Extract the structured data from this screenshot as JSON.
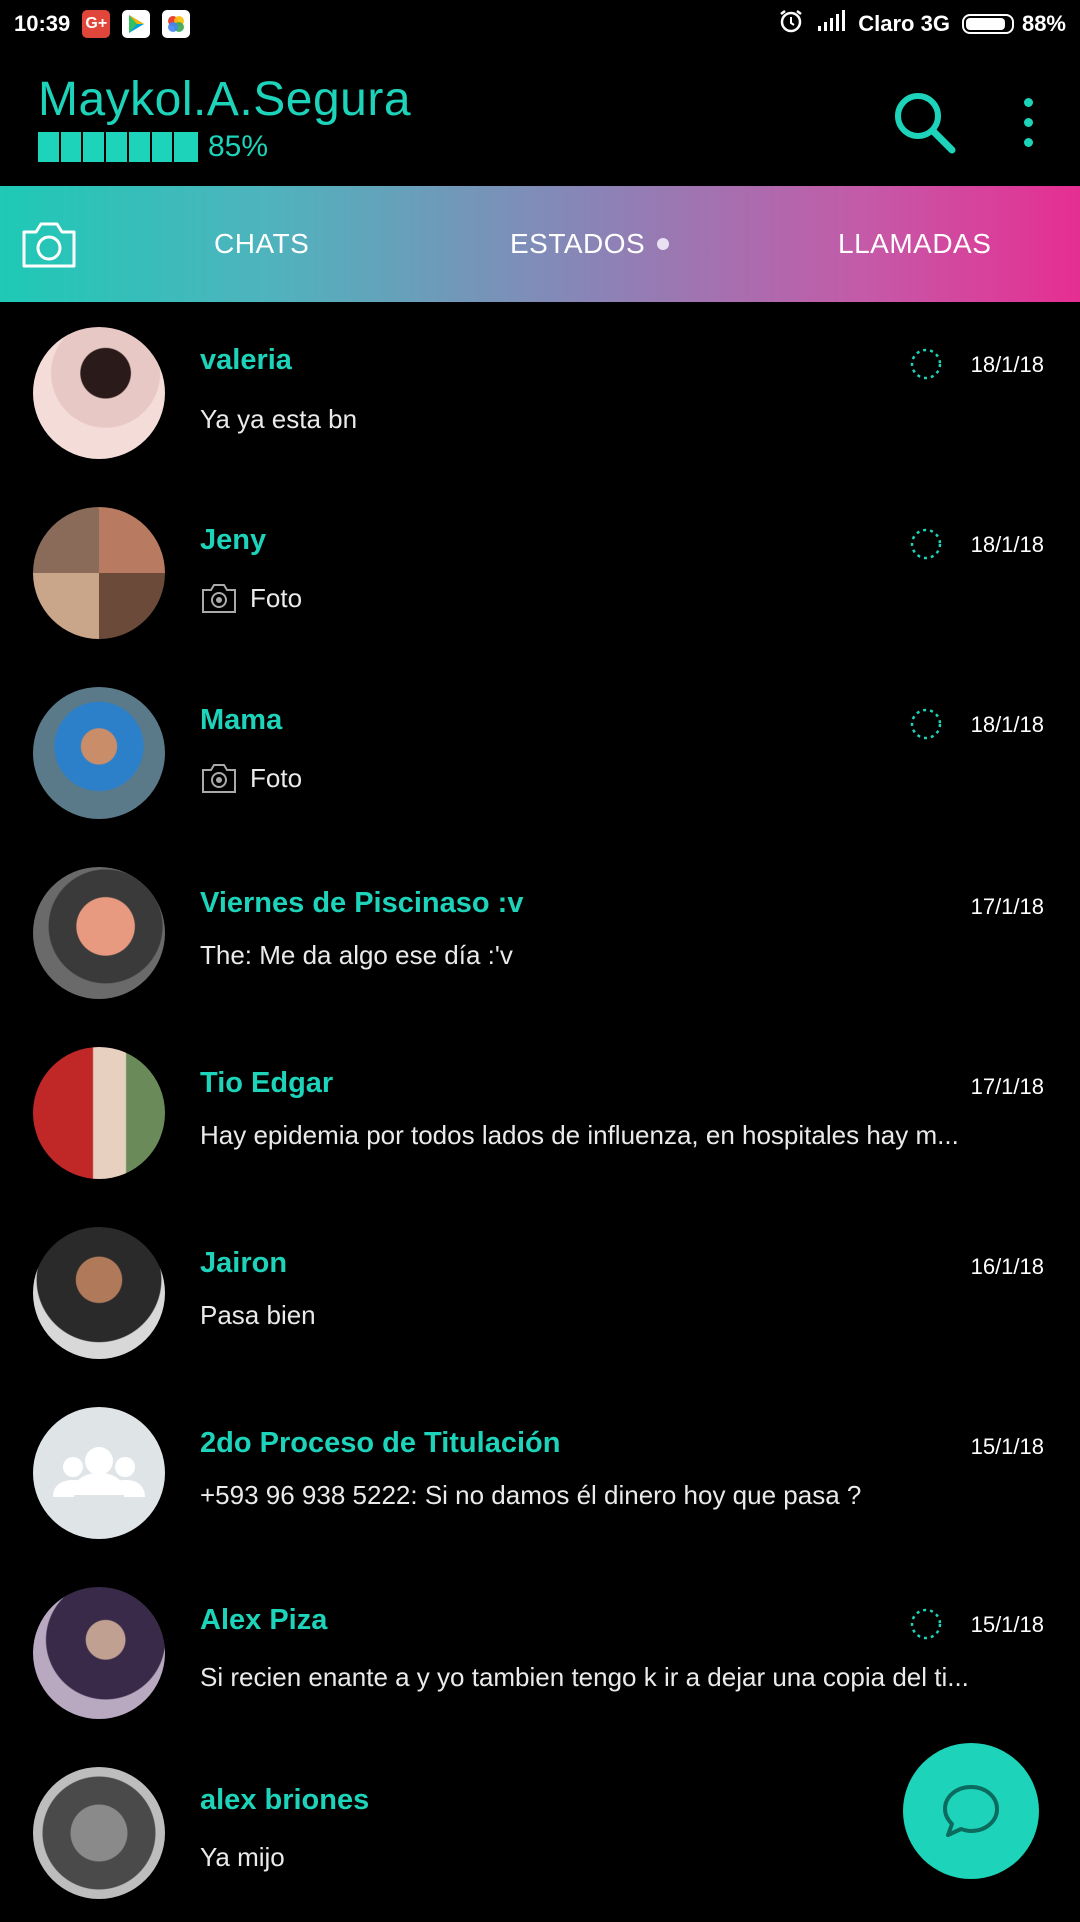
{
  "status_bar": {
    "time": "10:39",
    "carrier": "Claro 3G",
    "battery": "88%",
    "battery_level": 0.88,
    "icons": [
      "google-plus-icon",
      "play-store-icon",
      "google-photos-icon",
      "alarm-icon",
      "signal-icon",
      "battery-icon"
    ]
  },
  "header": {
    "title": "Maykol.A.Segura",
    "battery_widget": "85%",
    "battery_widget_level": 0.85,
    "accent_color": "#1dd3b9"
  },
  "tabs": [
    {
      "label": "CHATS"
    },
    {
      "label": "ESTADOS"
    },
    {
      "label": "LLAMADAS"
    }
  ],
  "chats": [
    {
      "name": "valeria",
      "message": "Ya ya esta bn",
      "date": "18/1/18",
      "status_ring": true,
      "photo": false
    },
    {
      "name": "Jeny",
      "message": "Foto",
      "date": "18/1/18",
      "status_ring": true,
      "photo": true
    },
    {
      "name": "Mama",
      "message": "Foto",
      "date": "18/1/18",
      "status_ring": true,
      "photo": true
    },
    {
      "name": "Viernes de Piscinaso :v",
      "message": "The: Me da algo ese día :'v",
      "date": "17/1/18",
      "status_ring": false,
      "photo": false
    },
    {
      "name": "Tio Edgar",
      "message": "Hay epidemia por todos lados de influenza, en hospitales hay m...",
      "date": "17/1/18",
      "status_ring": false,
      "photo": false
    },
    {
      "name": "Jairon",
      "message": "Pasa bien",
      "date": "16/1/18",
      "status_ring": false,
      "photo": false
    },
    {
      "name": "2do Proceso de Titulación",
      "message": "+593 96 938 5222: Si no  damos él dinero hoy que pasa ?",
      "date": "15/1/18",
      "status_ring": false,
      "photo": false
    },
    {
      "name": "Alex Piza",
      "message": "Si recien enante a y yo tambien  tengo k ir a dejar una copia del ti...",
      "date": "15/1/18",
      "status_ring": true,
      "photo": false
    },
    {
      "name": "alex briones",
      "message": "Ya mijo",
      "date": "",
      "status_ring": false,
      "photo": false
    }
  ],
  "fab": {
    "icon": "new-chat-icon"
  }
}
